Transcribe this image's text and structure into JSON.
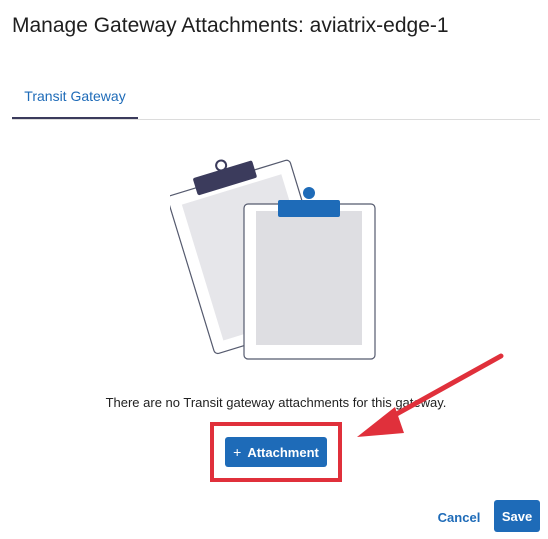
{
  "dialog": {
    "title": "Manage Gateway Attachments: aviatrix-edge-1"
  },
  "tabs": [
    {
      "label": "Transit Gateway",
      "active": true
    }
  ],
  "empty_state": {
    "message": "There are no Transit gateway attachments for this gateway.",
    "illustration_icon": "clipboard-icon"
  },
  "actions": {
    "add_attachment_icon": "+",
    "add_attachment_label": "Attachment",
    "cancel_label": "Cancel",
    "save_label": "Save"
  },
  "annotation": {
    "highlight_color": "#e0303b",
    "arrow_color": "#e0303b"
  },
  "colors": {
    "accent": "#1e6bb8",
    "tab_underline": "#3b3b5c"
  }
}
